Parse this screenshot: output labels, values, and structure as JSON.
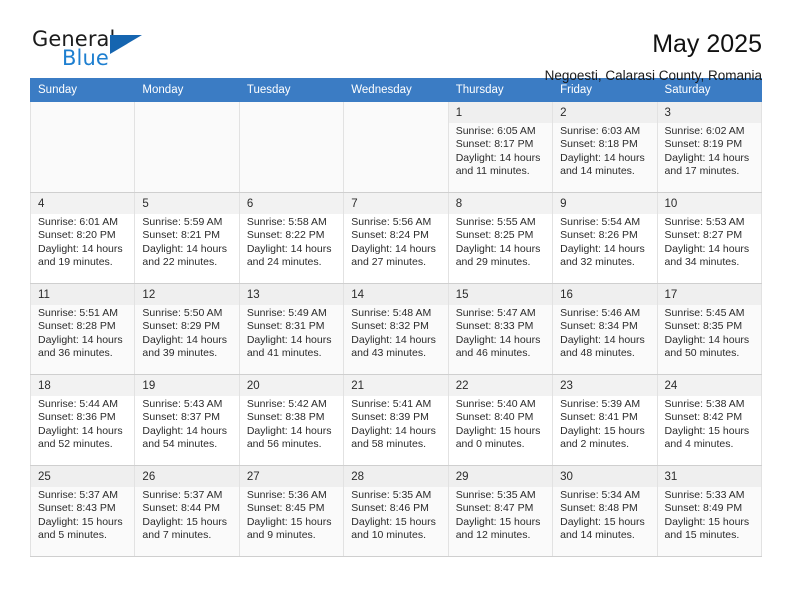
{
  "brand": {
    "name_top": "General",
    "name_bottom": "Blue",
    "accent_color": "#1e7fd0",
    "triangle_color": "#1565b0"
  },
  "header": {
    "title": "May 2025",
    "subtitle": "Negoesti, Calarasi County, Romania"
  },
  "calendar": {
    "header_bg": "#3b7cc4",
    "weekdays": [
      "Sunday",
      "Monday",
      "Tuesday",
      "Wednesday",
      "Thursday",
      "Friday",
      "Saturday"
    ],
    "weeks": [
      [
        {
          "day": "",
          "sunrise": "",
          "sunset": "",
          "daylight1": "",
          "daylight2": ""
        },
        {
          "day": "",
          "sunrise": "",
          "sunset": "",
          "daylight1": "",
          "daylight2": ""
        },
        {
          "day": "",
          "sunrise": "",
          "sunset": "",
          "daylight1": "",
          "daylight2": ""
        },
        {
          "day": "",
          "sunrise": "",
          "sunset": "",
          "daylight1": "",
          "daylight2": ""
        },
        {
          "day": "1",
          "sunrise": "Sunrise: 6:05 AM",
          "sunset": "Sunset: 8:17 PM",
          "daylight1": "Daylight: 14 hours",
          "daylight2": "and 11 minutes."
        },
        {
          "day": "2",
          "sunrise": "Sunrise: 6:03 AM",
          "sunset": "Sunset: 8:18 PM",
          "daylight1": "Daylight: 14 hours",
          "daylight2": "and 14 minutes."
        },
        {
          "day": "3",
          "sunrise": "Sunrise: 6:02 AM",
          "sunset": "Sunset: 8:19 PM",
          "daylight1": "Daylight: 14 hours",
          "daylight2": "and 17 minutes."
        }
      ],
      [
        {
          "day": "4",
          "sunrise": "Sunrise: 6:01 AM",
          "sunset": "Sunset: 8:20 PM",
          "daylight1": "Daylight: 14 hours",
          "daylight2": "and 19 minutes."
        },
        {
          "day": "5",
          "sunrise": "Sunrise: 5:59 AM",
          "sunset": "Sunset: 8:21 PM",
          "daylight1": "Daylight: 14 hours",
          "daylight2": "and 22 minutes."
        },
        {
          "day": "6",
          "sunrise": "Sunrise: 5:58 AM",
          "sunset": "Sunset: 8:22 PM",
          "daylight1": "Daylight: 14 hours",
          "daylight2": "and 24 minutes."
        },
        {
          "day": "7",
          "sunrise": "Sunrise: 5:56 AM",
          "sunset": "Sunset: 8:24 PM",
          "daylight1": "Daylight: 14 hours",
          "daylight2": "and 27 minutes."
        },
        {
          "day": "8",
          "sunrise": "Sunrise: 5:55 AM",
          "sunset": "Sunset: 8:25 PM",
          "daylight1": "Daylight: 14 hours",
          "daylight2": "and 29 minutes."
        },
        {
          "day": "9",
          "sunrise": "Sunrise: 5:54 AM",
          "sunset": "Sunset: 8:26 PM",
          "daylight1": "Daylight: 14 hours",
          "daylight2": "and 32 minutes."
        },
        {
          "day": "10",
          "sunrise": "Sunrise: 5:53 AM",
          "sunset": "Sunset: 8:27 PM",
          "daylight1": "Daylight: 14 hours",
          "daylight2": "and 34 minutes."
        }
      ],
      [
        {
          "day": "11",
          "sunrise": "Sunrise: 5:51 AM",
          "sunset": "Sunset: 8:28 PM",
          "daylight1": "Daylight: 14 hours",
          "daylight2": "and 36 minutes."
        },
        {
          "day": "12",
          "sunrise": "Sunrise: 5:50 AM",
          "sunset": "Sunset: 8:29 PM",
          "daylight1": "Daylight: 14 hours",
          "daylight2": "and 39 minutes."
        },
        {
          "day": "13",
          "sunrise": "Sunrise: 5:49 AM",
          "sunset": "Sunset: 8:31 PM",
          "daylight1": "Daylight: 14 hours",
          "daylight2": "and 41 minutes."
        },
        {
          "day": "14",
          "sunrise": "Sunrise: 5:48 AM",
          "sunset": "Sunset: 8:32 PM",
          "daylight1": "Daylight: 14 hours",
          "daylight2": "and 43 minutes."
        },
        {
          "day": "15",
          "sunrise": "Sunrise: 5:47 AM",
          "sunset": "Sunset: 8:33 PM",
          "daylight1": "Daylight: 14 hours",
          "daylight2": "and 46 minutes."
        },
        {
          "day": "16",
          "sunrise": "Sunrise: 5:46 AM",
          "sunset": "Sunset: 8:34 PM",
          "daylight1": "Daylight: 14 hours",
          "daylight2": "and 48 minutes."
        },
        {
          "day": "17",
          "sunrise": "Sunrise: 5:45 AM",
          "sunset": "Sunset: 8:35 PM",
          "daylight1": "Daylight: 14 hours",
          "daylight2": "and 50 minutes."
        }
      ],
      [
        {
          "day": "18",
          "sunrise": "Sunrise: 5:44 AM",
          "sunset": "Sunset: 8:36 PM",
          "daylight1": "Daylight: 14 hours",
          "daylight2": "and 52 minutes."
        },
        {
          "day": "19",
          "sunrise": "Sunrise: 5:43 AM",
          "sunset": "Sunset: 8:37 PM",
          "daylight1": "Daylight: 14 hours",
          "daylight2": "and 54 minutes."
        },
        {
          "day": "20",
          "sunrise": "Sunrise: 5:42 AM",
          "sunset": "Sunset: 8:38 PM",
          "daylight1": "Daylight: 14 hours",
          "daylight2": "and 56 minutes."
        },
        {
          "day": "21",
          "sunrise": "Sunrise: 5:41 AM",
          "sunset": "Sunset: 8:39 PM",
          "daylight1": "Daylight: 14 hours",
          "daylight2": "and 58 minutes."
        },
        {
          "day": "22",
          "sunrise": "Sunrise: 5:40 AM",
          "sunset": "Sunset: 8:40 PM",
          "daylight1": "Daylight: 15 hours",
          "daylight2": "and 0 minutes."
        },
        {
          "day": "23",
          "sunrise": "Sunrise: 5:39 AM",
          "sunset": "Sunset: 8:41 PM",
          "daylight1": "Daylight: 15 hours",
          "daylight2": "and 2 minutes."
        },
        {
          "day": "24",
          "sunrise": "Sunrise: 5:38 AM",
          "sunset": "Sunset: 8:42 PM",
          "daylight1": "Daylight: 15 hours",
          "daylight2": "and 4 minutes."
        }
      ],
      [
        {
          "day": "25",
          "sunrise": "Sunrise: 5:37 AM",
          "sunset": "Sunset: 8:43 PM",
          "daylight1": "Daylight: 15 hours",
          "daylight2": "and 5 minutes."
        },
        {
          "day": "26",
          "sunrise": "Sunrise: 5:37 AM",
          "sunset": "Sunset: 8:44 PM",
          "daylight1": "Daylight: 15 hours",
          "daylight2": "and 7 minutes."
        },
        {
          "day": "27",
          "sunrise": "Sunrise: 5:36 AM",
          "sunset": "Sunset: 8:45 PM",
          "daylight1": "Daylight: 15 hours",
          "daylight2": "and 9 minutes."
        },
        {
          "day": "28",
          "sunrise": "Sunrise: 5:35 AM",
          "sunset": "Sunset: 8:46 PM",
          "daylight1": "Daylight: 15 hours",
          "daylight2": "and 10 minutes."
        },
        {
          "day": "29",
          "sunrise": "Sunrise: 5:35 AM",
          "sunset": "Sunset: 8:47 PM",
          "daylight1": "Daylight: 15 hours",
          "daylight2": "and 12 minutes."
        },
        {
          "day": "30",
          "sunrise": "Sunrise: 5:34 AM",
          "sunset": "Sunset: 8:48 PM",
          "daylight1": "Daylight: 15 hours",
          "daylight2": "and 14 minutes."
        },
        {
          "day": "31",
          "sunrise": "Sunrise: 5:33 AM",
          "sunset": "Sunset: 8:49 PM",
          "daylight1": "Daylight: 15 hours",
          "daylight2": "and 15 minutes."
        }
      ]
    ]
  }
}
